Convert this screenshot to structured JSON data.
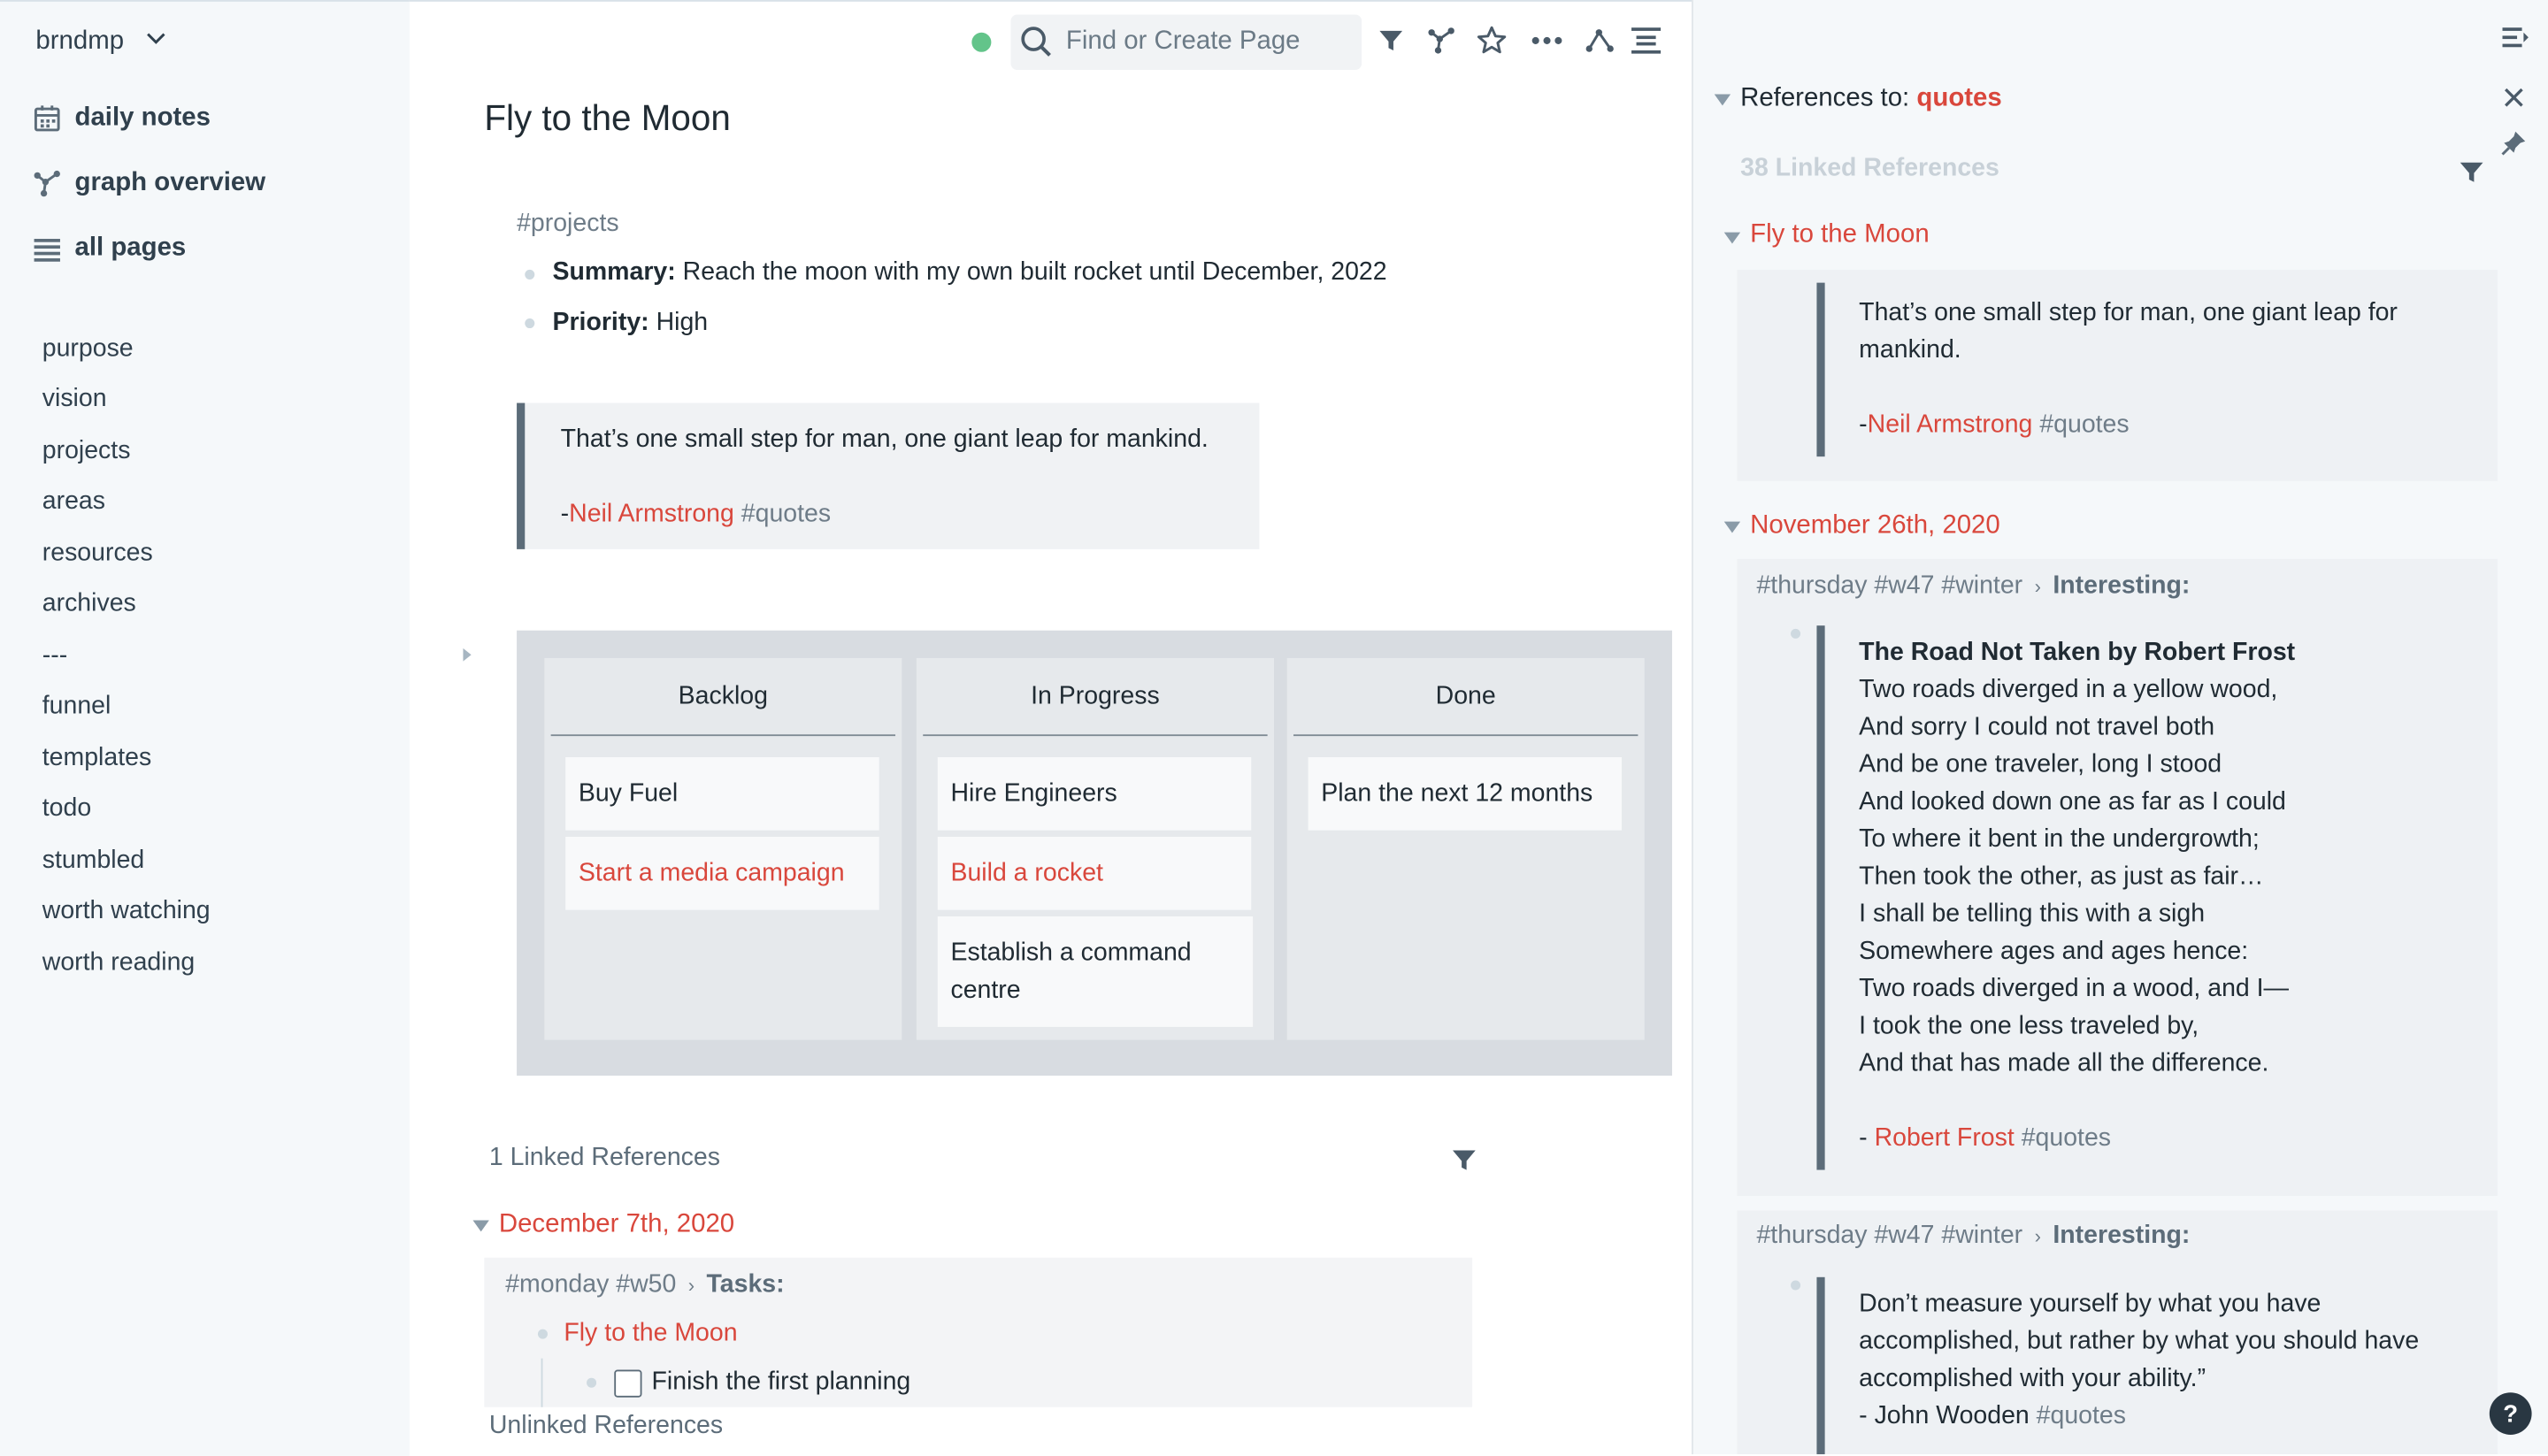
{
  "sidebar": {
    "graph_name": "brndmp",
    "nav": [
      {
        "label": "daily notes",
        "icon": "calendar-icon"
      },
      {
        "label": "graph overview",
        "icon": "graph-icon"
      },
      {
        "label": "all pages",
        "icon": "list-icon"
      }
    ],
    "shortcuts": [
      "purpose",
      "vision",
      "projects",
      "areas",
      "resources",
      "archives",
      "---",
      "funnel",
      "templates",
      "todo",
      "stumbled",
      "worth watching",
      "worth reading"
    ]
  },
  "topbar": {
    "search_placeholder": "Find or Create Page",
    "sync_color": "#63C48A"
  },
  "page": {
    "title": "Fly to the Moon",
    "tag": "#projects",
    "summary_label": "Summary:",
    "summary_value": "Reach the moon with my own built rocket until December, 2022",
    "priority_label": "Priority:",
    "priority_value": "High",
    "quote": {
      "text": "That’s one small step for man, one giant leap for mankind.",
      "dash": "-",
      "author": "Neil Armstrong",
      "tag": "#quotes"
    },
    "kanban": {
      "columns": [
        {
          "title": "Backlog",
          "cards": [
            {
              "text": "Buy Fuel",
              "link": false
            },
            {
              "text": "Start a media campaign",
              "link": true
            }
          ]
        },
        {
          "title": "In Progress",
          "cards": [
            {
              "text": "Hire Engineers",
              "link": false
            },
            {
              "text": "Build a rocket",
              "link": true
            },
            {
              "text": "Establish a command centre",
              "link": false
            }
          ]
        },
        {
          "title": "Done",
          "cards": [
            {
              "text": "Plan the next 12 months",
              "link": false
            }
          ]
        }
      ]
    },
    "linked_refs": {
      "title": "1 Linked References",
      "date": "December 7th, 2020",
      "breadcrumb_tags": "#monday #w50",
      "breadcrumb_parent": "Tasks:",
      "item_link": "Fly to the Moon",
      "todo": "Finish the first planning"
    },
    "unlinked_refs": "Unlinked References"
  },
  "right": {
    "header_prefix": "References to:",
    "header_page": "quotes",
    "count": "38 Linked References",
    "groups": [
      {
        "title": "Fly to the Moon",
        "quote_line1": "That’s one small step for man, one giant leap for",
        "quote_line2": "mankind.",
        "dash": "-",
        "author": "Neil Armstrong",
        "tag": "#quotes"
      },
      {
        "title": "November 26th, 2020",
        "crumb_tags": "#thursday #w47 #winter",
        "crumb_parent": "Interesting:",
        "poem_title": "The Road Not Taken by Robert Frost",
        "poem": [
          "Two roads diverged in a yellow wood,",
          "And sorry I could not travel both",
          "And be one traveler, long I stood",
          "And looked down one as far as I could",
          "To where it bent in the undergrowth;",
          "Then took the other, as just as fair…",
          "I shall be telling this with a sigh",
          "Somewhere ages and ages hence:",
          "Two roads diverged in a wood, and I—",
          "I took the one less traveled by,",
          "And that has made all the difference."
        ],
        "dash": "- ",
        "author": "Robert Frost",
        "tag": "#quotes"
      },
      {
        "crumb_tags": "#thursday #w47 #winter",
        "crumb_parent": "Interesting:",
        "lines": [
          "Don’t measure yourself by what you have",
          "accomplished, but rather by what you should have",
          "accomplished with your ability.”"
        ],
        "last_line": "- John Wooden",
        "tag": "#quotes"
      }
    ],
    "help": "?"
  }
}
